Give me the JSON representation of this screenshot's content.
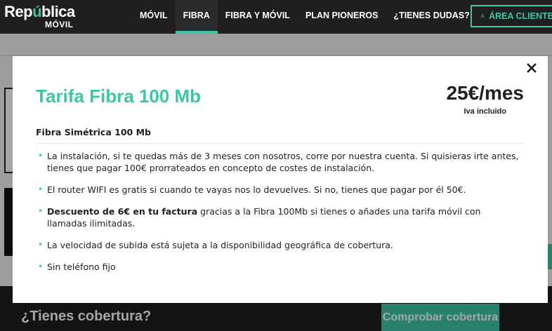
{
  "brand": {
    "name_prefix": "Rep",
    "name_accent": "ú",
    "name_suffix": "blica",
    "sub": "MÓVIL"
  },
  "nav": {
    "items": [
      {
        "label": "MÓVIL"
      },
      {
        "label": "FIBRA",
        "active": true
      },
      {
        "label": "FIBRA Y MÓVIL"
      },
      {
        "label": "PLAN PIONEROS"
      },
      {
        "label": "¿TIENES DUDAS?"
      }
    ],
    "account_label": "ÁREA CLIENTE"
  },
  "modal": {
    "title": "Tarifa Fibra 100 Mb",
    "price": "25€/mes",
    "price_note": "Iva incluido",
    "subtitle": "Fibra Simétrica 100 Mb",
    "features": [
      {
        "text": "La instalación, si te quedas más de 3 meses con nosotros, corre por nuestra cuenta. Si quisieras irte antes, tienes que pagar 100€ prorrateados en concepto de costes de instalación."
      },
      {
        "text": "El router WIFI es gratis si cuando te vayas nos lo devuelves. Si no, tienes que pagar por él 50€."
      },
      {
        "bold": "Descuento de 6€ en tu factura",
        "text": " gracias a la Fibra 100Mb si tienes o añades una tarifa móvil con llamadas ilimitadas."
      },
      {
        "text": "La velocidad de subida está sujeta a la disponibilidad geográfica de cobertura."
      },
      {
        "text": "Sin teléfono fijo"
      }
    ]
  },
  "coverage": {
    "title": "¿Tienes cobertura?",
    "button": "Comprobar cobertura"
  },
  "colors": {
    "accent": "#3ec6a3",
    "dark": "#1f1f1f"
  }
}
